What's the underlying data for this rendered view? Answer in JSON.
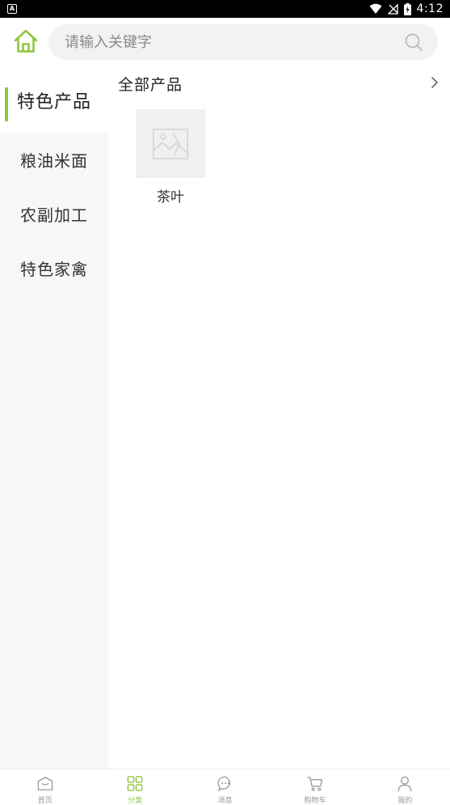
{
  "status_bar": {
    "time": "4:12",
    "app_badge": "A"
  },
  "header": {
    "search_placeholder": "请输入关键字"
  },
  "sidebar": {
    "items": [
      {
        "label": "特色产品",
        "active": true
      },
      {
        "label": "粮油米面",
        "active": false
      },
      {
        "label": "农副加工",
        "active": false
      },
      {
        "label": "特色家禽",
        "active": false
      }
    ]
  },
  "content": {
    "section_title": "全部产品",
    "products": [
      {
        "name": "茶叶"
      }
    ]
  },
  "tabbar": {
    "tabs": [
      {
        "label": "首页",
        "icon": "home-icon",
        "active": false
      },
      {
        "label": "分类",
        "icon": "category-icon",
        "active": true
      },
      {
        "label": "消息",
        "icon": "message-icon",
        "active": false
      },
      {
        "label": "购物车",
        "icon": "cart-icon",
        "active": false
      },
      {
        "label": "我的",
        "icon": "user-icon",
        "active": false
      }
    ]
  },
  "colors": {
    "accent": "#8dc63f",
    "sidebar_bg": "#f7f7f7",
    "search_bg": "#f2f2f2",
    "inactive_tab": "#999999"
  }
}
